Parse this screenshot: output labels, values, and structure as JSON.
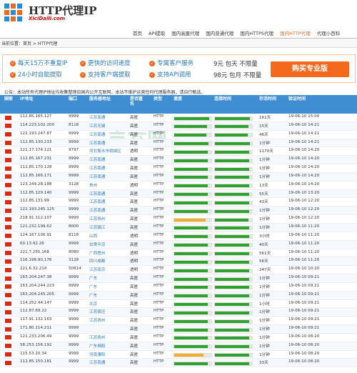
{
  "site": {
    "title": "HTTP代理IP",
    "url": "XiciDaili.com"
  },
  "nav": [
    "首页",
    "API提取",
    "国内高匿代理",
    "国内普通代理",
    "国内HTTPS代理",
    "国内HTTP代理",
    "代理小百科"
  ],
  "breadcrumb": "当前位置：首页 > HTTP代理",
  "promo": {
    "items": [
      "每天15万不重复IP",
      "更快的访问速度",
      "专属客户服务",
      "24小时自助提取",
      "支持客户端提取",
      "支持API调用"
    ],
    "price1": "9元 包天 不限量",
    "price2": "98元 包月 不限量",
    "buy": "购买专业版"
  },
  "notice": "公告：本站所有代理IP地址均收集整理自国内公开互联网，本站不维护运营任何代理服务器，请自行甄选。",
  "watermark": "吉云网",
  "table": {
    "headers": {
      "country": "国家",
      "ip": "IP地址",
      "port": "端口",
      "addr": "服务器地址",
      "anon": "是否匿名",
      "type": "类型",
      "speed": "速度",
      "conn": "连接时间",
      "alive": "存活时间",
      "verify": "验证时间"
    },
    "rows": [
      {
        "ip": "112.85.165.127",
        "port": "9999",
        "addr": "江苏南通",
        "anon": "高匿",
        "type": "HTTP",
        "speed": 0.95,
        "sc": "#2ea12e",
        "conn": 0.95,
        "cc": "#2ea12e",
        "alive": "161天",
        "verify": "19-06-10 15:00"
      },
      {
        "ip": "114.223.102.200",
        "port": "8118",
        "addr": "江苏无锡",
        "anon": "高匿",
        "type": "HTTP",
        "speed": 0.88,
        "sc": "#2ea12e",
        "conn": 0.9,
        "cc": "#2ea12e",
        "alive": "15天",
        "verify": "19-06-10 14:21"
      },
      {
        "ip": "122.193.247.87",
        "port": "9999",
        "addr": "江苏南通",
        "anon": "高匿",
        "type": "HTTP",
        "speed": 0.87,
        "sc": "#2ea12e",
        "conn": 0.88,
        "cc": "#2ea12e",
        "alive": "46天",
        "verify": "19-06-10 14:21"
      },
      {
        "ip": "112.85.130.233",
        "port": "9999",
        "addr": "江苏南通",
        "anon": "高匿",
        "type": "HTTP",
        "speed": 0.93,
        "sc": "#2ea12e",
        "conn": 0.95,
        "cc": "#2ea12e",
        "alive": "1分钟",
        "verify": "19-06-10 14:21"
      },
      {
        "ip": "121.17.174.121",
        "port": "9797",
        "addr": "河北衡水市桃城区",
        "anon": "透明",
        "type": "HTTP",
        "speed": 0.9,
        "sc": "#2ea12e",
        "conn": 0.92,
        "cc": "#2ea12e",
        "alive": "1170天",
        "verify": "19-06-10 14:20"
      },
      {
        "ip": "112.85.167.231",
        "port": "9999",
        "addr": "江苏南通",
        "anon": "高匿",
        "type": "HTTP",
        "speed": 0.9,
        "sc": "#2ea12e",
        "conn": 0.92,
        "cc": "#2ea12e",
        "alive": "1分钟",
        "verify": "19-06-10 14:20"
      },
      {
        "ip": "112.85.170.128",
        "port": "9999",
        "addr": "江苏南通",
        "anon": "高匿",
        "type": "HTTP",
        "speed": 0.9,
        "sc": "#2ea12e",
        "conn": 0.92,
        "cc": "#2ea12e",
        "alive": "1分钟",
        "verify": "19-06-10 14:20"
      },
      {
        "ip": "112.85.166.171",
        "port": "9999",
        "addr": "江苏南通",
        "anon": "高匿",
        "type": "HTTP",
        "speed": 0.9,
        "sc": "#2ea12e",
        "conn": 0.92,
        "cc": "#2ea12e",
        "alive": "1分钟",
        "verify": "19-06-10 14:20"
      },
      {
        "ip": "123.249.28.188",
        "port": "3128",
        "addr": "贵州",
        "anon": "透明",
        "type": "HTTP",
        "speed": 0.9,
        "sc": "#2ea12e",
        "conn": 0.92,
        "cc": "#2ea12e",
        "alive": "13天",
        "verify": "19-06-10 14:20"
      },
      {
        "ip": "112.85.129.140",
        "port": "9999",
        "addr": "江苏南通",
        "anon": "高匿",
        "type": "HTTP",
        "speed": 0.9,
        "sc": "#2ea12e",
        "conn": 0.92,
        "cc": "#2ea12e",
        "alive": "55天",
        "verify": "19-06-10 13:20"
      },
      {
        "ip": "112.85.131.99",
        "port": "9999",
        "addr": "江苏南通",
        "anon": "高匿",
        "type": "HTTP",
        "speed": 0.9,
        "sc": "#2ea12e",
        "conn": 0.92,
        "cc": "#2ea12e",
        "alive": "43天",
        "verify": "19-06-10 12:20"
      },
      {
        "ip": "122.193.245.125",
        "port": "9999",
        "addr": "江苏南通",
        "anon": "高匿",
        "type": "HTTP",
        "speed": 0.9,
        "sc": "#2ea12e",
        "conn": 0.92,
        "cc": "#2ea12e",
        "alive": "1分钟",
        "verify": "19-06-10 12:20"
      },
      {
        "ip": "218.91.112.107",
        "port": "9999",
        "addr": "江苏扬州",
        "anon": "高匿",
        "type": "HTTP",
        "speed": 0.85,
        "sc": "#f0ad2e",
        "conn": 0.9,
        "cc": "#2ea12e",
        "alive": "1分钟",
        "verify": "19-06-10 12:20"
      },
      {
        "ip": "121.232.199.62",
        "port": "8000",
        "addr": "江苏镇江",
        "anon": "高匿",
        "type": "HTTP",
        "speed": 0.9,
        "sc": "#2ea12e",
        "conn": 0.92,
        "cc": "#2ea12e",
        "alive": "1分钟",
        "verify": "19-06-10 11:20"
      },
      {
        "ip": "124.167.106.91",
        "port": "8118",
        "addr": "山西",
        "anon": "透明",
        "type": "HTTP",
        "speed": 0.9,
        "sc": "#2ea12e",
        "conn": 0.92,
        "cc": "#2ea12e",
        "alive": "3小时",
        "verify": "19-06-10 11:20"
      },
      {
        "ip": "60.13.42.26",
        "port": "9999",
        "addr": "甘肃平凉",
        "anon": "高匿",
        "type": "HTTP",
        "speed": 0.9,
        "sc": "#2ea12e",
        "conn": 0.92,
        "cc": "#2ea12e",
        "alive": "40天",
        "verify": "19-06-10 11:20"
      },
      {
        "ip": "221.7.255.168",
        "port": "8080",
        "addr": "广西梧州",
        "anon": "透明",
        "type": "HTTP",
        "speed": 0.9,
        "sc": "#2ea12e",
        "conn": 0.92,
        "cc": "#2ea12e",
        "alive": "561天",
        "verify": "19-06-10 11:20"
      },
      {
        "ip": "116.196.90.176",
        "port": "3128",
        "addr": "四川成都",
        "anon": "透明",
        "type": "HTTP",
        "speed": 0.9,
        "sc": "#2ea12e",
        "conn": 0.92,
        "cc": "#2ea12e",
        "alive": "56天",
        "verify": "19-06-10 11:20"
      },
      {
        "ip": "221.6.32.214",
        "port": "50814",
        "addr": "江苏南京",
        "anon": "透明",
        "type": "HTTP",
        "speed": 0.9,
        "sc": "#2ea12e",
        "conn": 0.92,
        "cc": "#2ea12e",
        "alive": "247天",
        "verify": "19-06-10 10:20"
      },
      {
        "ip": "163.204.247.38",
        "port": "9999",
        "addr": "广东",
        "anon": "高匿",
        "type": "HTTP",
        "speed": 0.9,
        "sc": "#2ea12e",
        "conn": 0.92,
        "cc": "#2ea12e",
        "alive": "1分钟",
        "verify": "19-06-10 09:21"
      },
      {
        "ip": "163.204.244.223",
        "port": "9999",
        "addr": "广东",
        "anon": "高匿",
        "type": "HTTP",
        "speed": 0.9,
        "sc": "#2ea12e",
        "conn": 0.92,
        "cc": "#2ea12e",
        "alive": "1分钟",
        "verify": "19-06-10 09:21"
      },
      {
        "ip": "163.204.245.205",
        "port": "9999",
        "addr": "广东",
        "anon": "高匿",
        "type": "HTTP",
        "speed": 0.9,
        "sc": "#2ea12e",
        "conn": 0.92,
        "cc": "#2ea12e",
        "alive": "1分钟",
        "verify": "19-06-10 09:21"
      },
      {
        "ip": "114.252.44.147",
        "port": "9999",
        "addr": "北京",
        "anon": "高匿",
        "type": "HTTP",
        "speed": 0.9,
        "sc": "#2ea12e",
        "conn": 0.92,
        "cc": "#2ea12e",
        "alive": "1小时",
        "verify": "19-06-10 09:21"
      },
      {
        "ip": "112.87.69.22",
        "port": "9999",
        "addr": "江苏宿迁",
        "anon": "高匿",
        "type": "HTTP",
        "speed": 0.9,
        "sc": "#2ea12e",
        "conn": 0.92,
        "cc": "#2ea12e",
        "alive": "1分钟",
        "verify": "19-06-10 09:21"
      },
      {
        "ip": "117.91.132.163",
        "port": "9999",
        "addr": "江苏扬州",
        "anon": "高匿",
        "type": "HTTP",
        "speed": 0.9,
        "sc": "#2ea12e",
        "conn": 0.92,
        "cc": "#2ea12e",
        "alive": "1分钟",
        "verify": "19-06-10 09:21"
      },
      {
        "ip": "171.80.114.211",
        "port": "9999",
        "addr": "",
        "anon": "高匿",
        "type": "HTTP",
        "speed": 0.9,
        "sc": "#2ea12e",
        "conn": 0.92,
        "cc": "#2ea12e",
        "alive": "1分钟",
        "verify": "19-06-10 09:21"
      },
      {
        "ip": "121.233.206.49",
        "port": "9999",
        "addr": "江苏扬州",
        "anon": "高匿",
        "type": "HTTP",
        "speed": 0.9,
        "sc": "#2ea12e",
        "conn": 0.92,
        "cc": "#2ea12e",
        "alive": "1分钟",
        "verify": "19-06-10 08:20"
      },
      {
        "ip": "58.253.156.192",
        "port": "9999",
        "addr": "广东揭阳",
        "anon": "高匿",
        "type": "HTTP",
        "speed": 0.9,
        "sc": "#2ea12e",
        "conn": 0.92,
        "cc": "#2ea12e",
        "alive": "1分钟",
        "verify": "19-06-10 08:20"
      },
      {
        "ip": "115.53.20.34",
        "port": "9999",
        "addr": "河南濮阳",
        "anon": "高匿",
        "type": "HTTP",
        "speed": 0.78,
        "sc": "#f0ad2e",
        "conn": 0.92,
        "cc": "#2ea12e",
        "alive": "1分钟",
        "verify": "19-06-10 08:20"
      },
      {
        "ip": "112.85.150.181",
        "port": "9999",
        "addr": "江苏南通",
        "anon": "高匿",
        "type": "HTTP",
        "speed": 0.9,
        "sc": "#2ea12e",
        "conn": 0.92,
        "cc": "#2ea12e",
        "alive": "33天",
        "verify": "19-06-10 08:20"
      }
    ]
  }
}
